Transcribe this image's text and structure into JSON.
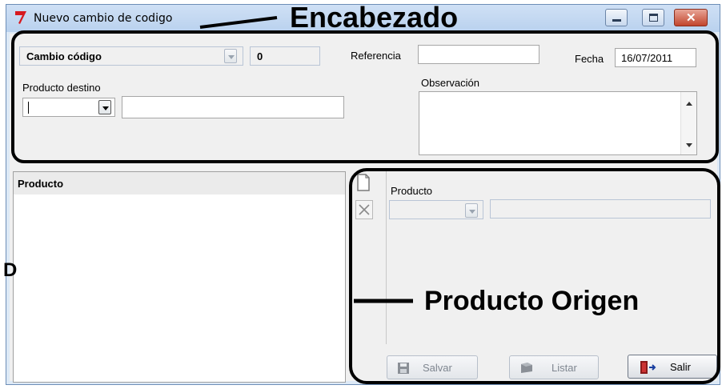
{
  "window": {
    "title": "Nuevo cambio de codigo",
    "controls": {
      "minimize": "minimize",
      "maximize": "maximize",
      "close": "close"
    }
  },
  "header": {
    "tipo": "Cambio código",
    "numero": "0",
    "referencia_label": "Referencia",
    "referencia_value": "",
    "fecha_label": "Fecha",
    "fecha_value": "16/07/2011",
    "producto_destino_label": "Producto destino",
    "producto_destino_code": "",
    "producto_destino_desc": "",
    "observacion_label": "Observación",
    "observacion_value": ""
  },
  "product_list": {
    "header": "Producto",
    "items": []
  },
  "origen": {
    "producto_label": "Producto",
    "producto_code": "",
    "producto_desc": ""
  },
  "buttons": {
    "salvar": "Salvar",
    "listar": "Listar",
    "salir": "Salir"
  },
  "annotations": {
    "encabezado": "Encabezado",
    "producto_origen": "Producto Origen",
    "detalle": "D"
  },
  "colors": {
    "title_bar": "#c4d8f1",
    "client_bg": "#f0f0f0",
    "close_button": "#c2452d",
    "app_icon": "#d7191f"
  }
}
